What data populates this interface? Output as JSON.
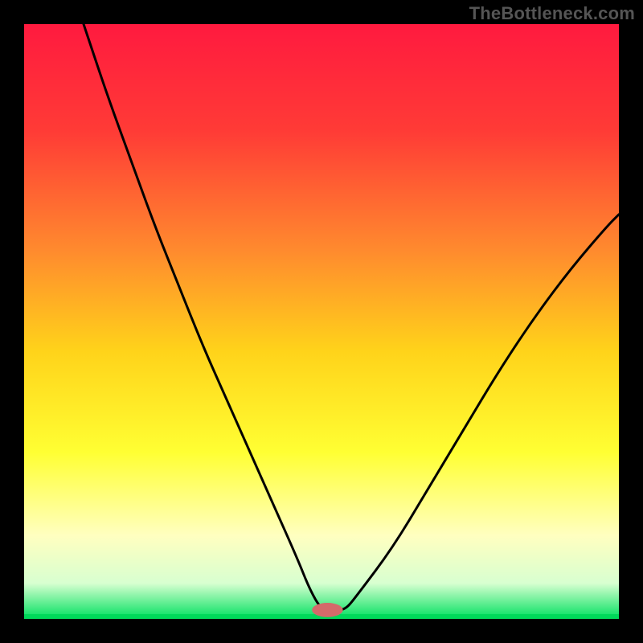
{
  "watermark": "TheBottleneck.com",
  "chart_data": {
    "type": "line",
    "title": "",
    "xlabel": "",
    "ylabel": "",
    "xlim": [
      0,
      100
    ],
    "ylim": [
      0,
      100
    ],
    "background_gradient": {
      "stops": [
        {
          "offset": 0.0,
          "color": "#ff1a3f"
        },
        {
          "offset": 0.18,
          "color": "#ff3b36"
        },
        {
          "offset": 0.38,
          "color": "#ff8a2e"
        },
        {
          "offset": 0.55,
          "color": "#ffd31a"
        },
        {
          "offset": 0.72,
          "color": "#ffff33"
        },
        {
          "offset": 0.86,
          "color": "#ffffc0"
        },
        {
          "offset": 0.94,
          "color": "#d8ffd0"
        },
        {
          "offset": 1.0,
          "color": "#00e060"
        }
      ]
    },
    "curve": {
      "x": [
        10,
        14,
        18,
        22,
        26,
        30,
        34,
        38,
        42,
        46,
        48,
        50,
        52,
        54,
        56,
        62,
        68,
        74,
        80,
        86,
        92,
        98,
        100
      ],
      "y": [
        100,
        88,
        77,
        66,
        56,
        46,
        37,
        28,
        19,
        10,
        5,
        1.5,
        1.5,
        1.5,
        4,
        12,
        22,
        32,
        42,
        51,
        59,
        66,
        68
      ]
    },
    "marker": {
      "x": 51,
      "y": 1.5,
      "rx": 2.6,
      "ry": 1.2,
      "color": "#d46a6a"
    },
    "baseline_y": 0.8
  }
}
